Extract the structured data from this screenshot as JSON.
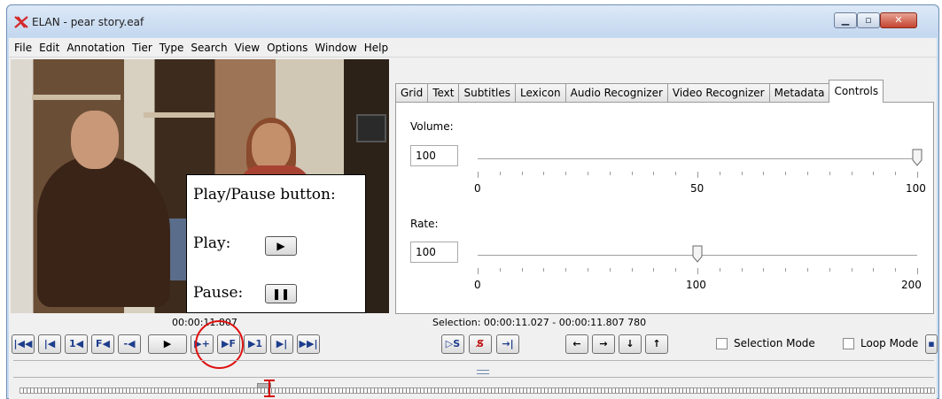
{
  "window": {
    "title": "ELAN - pear story.eaf"
  },
  "menu": [
    "File",
    "Edit",
    "Annotation",
    "Tier",
    "Type",
    "Search",
    "View",
    "Options",
    "Window",
    "Help"
  ],
  "overlay": {
    "title": "Play/Pause button:",
    "play_label": "Play:",
    "pause_label": "Pause:"
  },
  "tabs": [
    "Grid",
    "Text",
    "Subtitles",
    "Lexicon",
    "Audio Recognizer",
    "Video Recognizer",
    "Metadata",
    "Controls"
  ],
  "active_tab": "Controls",
  "controls": {
    "volume_label": "Volume:",
    "volume_value": "100",
    "volume_ticks": [
      "0",
      "50",
      "100"
    ],
    "volume_level_fraction": 1.0,
    "rate_label": "Rate:",
    "rate_value": "100",
    "rate_ticks": [
      "0",
      "100",
      "200"
    ],
    "rate_level_fraction": 0.5
  },
  "media": {
    "current_time": "00:00:11.807",
    "selection": "Selection: 00:00:11.027 - 00:00:11.807  780"
  },
  "toolbar": {
    "selection_mode_label": "Selection Mode",
    "loop_mode_label": "Loop Mode"
  },
  "colors": {
    "highlight_circle": "#e01010",
    "cursor": "#d40000"
  }
}
